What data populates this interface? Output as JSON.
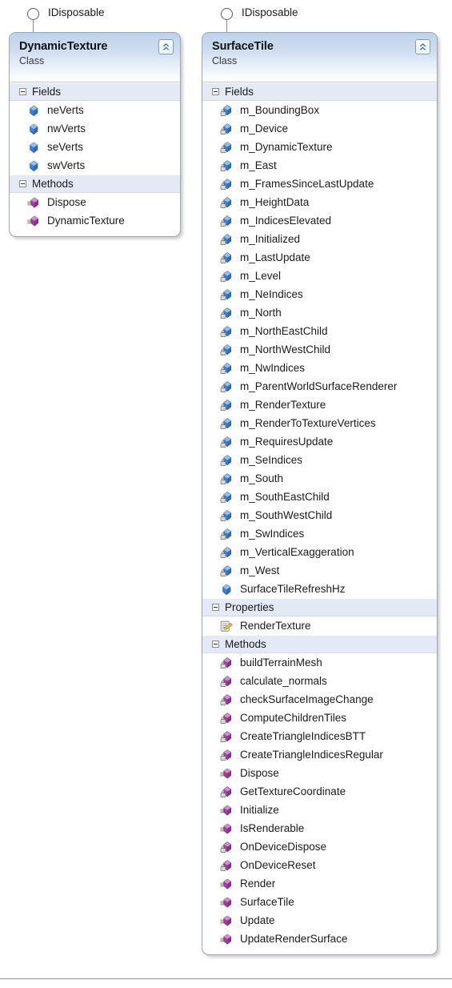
{
  "diagram": {
    "type": "uml-class-diagram",
    "background_color": "#ffffff",
    "accent_color": "#bcd2ea",
    "field_icon_color": "#3a78c8",
    "method_icon_color": "#a13fa1",
    "property_icon_color": "#e8b33c"
  },
  "classes": [
    {
      "id": "dynamic-texture",
      "name": "DynamicTexture",
      "stereotype": "Class",
      "interface_label": "IDisposable",
      "collapse_icon": "chevron-double-up-icon",
      "sections": [
        {
          "label": "Fields",
          "expander": "collapse-expander-icon",
          "members": [
            {
              "name": "neVerts",
              "icon": "field-public-icon"
            },
            {
              "name": "nwVerts",
              "icon": "field-public-icon"
            },
            {
              "name": "seVerts",
              "icon": "field-public-icon"
            },
            {
              "name": "swVerts",
              "icon": "field-public-icon"
            }
          ]
        },
        {
          "label": "Methods",
          "expander": "collapse-expander-icon",
          "members": [
            {
              "name": "Dispose",
              "icon": "method-public-icon"
            },
            {
              "name": "DynamicTexture",
              "icon": "method-public-icon"
            }
          ]
        }
      ]
    },
    {
      "id": "surface-tile",
      "name": "SurfaceTile",
      "stereotype": "Class",
      "interface_label": "IDisposable",
      "collapse_icon": "chevron-double-up-icon",
      "sections": [
        {
          "label": "Fields",
          "expander": "collapse-expander-icon",
          "members": [
            {
              "name": "m_BoundingBox",
              "icon": "field-private-icon"
            },
            {
              "name": "m_Device",
              "icon": "field-private-icon"
            },
            {
              "name": "m_DynamicTexture",
              "icon": "field-private-icon"
            },
            {
              "name": "m_East",
              "icon": "field-private-icon"
            },
            {
              "name": "m_FramesSinceLastUpdate",
              "icon": "field-private-icon"
            },
            {
              "name": "m_HeightData",
              "icon": "field-private-icon"
            },
            {
              "name": "m_IndicesElevated",
              "icon": "field-private-icon"
            },
            {
              "name": "m_Initialized",
              "icon": "field-private-icon"
            },
            {
              "name": "m_LastUpdate",
              "icon": "field-private-icon"
            },
            {
              "name": "m_Level",
              "icon": "field-private-icon"
            },
            {
              "name": "m_NeIndices",
              "icon": "field-private-icon"
            },
            {
              "name": "m_North",
              "icon": "field-private-icon"
            },
            {
              "name": "m_NorthEastChild",
              "icon": "field-private-icon"
            },
            {
              "name": "m_NorthWestChild",
              "icon": "field-private-icon"
            },
            {
              "name": "m_NwIndices",
              "icon": "field-private-icon"
            },
            {
              "name": "m_ParentWorldSurfaceRenderer",
              "icon": "field-private-icon"
            },
            {
              "name": "m_RenderTexture",
              "icon": "field-private-icon"
            },
            {
              "name": "m_RenderToTextureVertices",
              "icon": "field-private-icon"
            },
            {
              "name": "m_RequiresUpdate",
              "icon": "field-private-icon"
            },
            {
              "name": "m_SeIndices",
              "icon": "field-private-icon"
            },
            {
              "name": "m_South",
              "icon": "field-private-icon"
            },
            {
              "name": "m_SouthEastChild",
              "icon": "field-private-icon"
            },
            {
              "name": "m_SouthWestChild",
              "icon": "field-private-icon"
            },
            {
              "name": "m_SwIndices",
              "icon": "field-private-icon"
            },
            {
              "name": "m_VerticalExaggeration",
              "icon": "field-private-icon"
            },
            {
              "name": "m_West",
              "icon": "field-private-icon"
            },
            {
              "name": "SurfaceTileRefreshHz",
              "icon": "field-public-icon"
            }
          ]
        },
        {
          "label": "Properties",
          "expander": "collapse-expander-icon",
          "members": [
            {
              "name": "RenderTexture",
              "icon": "property-public-icon"
            }
          ]
        },
        {
          "label": "Methods",
          "expander": "collapse-expander-icon",
          "members": [
            {
              "name": "buildTerrainMesh",
              "icon": "method-private-icon"
            },
            {
              "name": "calculate_normals",
              "icon": "method-private-icon"
            },
            {
              "name": "checkSurfaceImageChange",
              "icon": "method-private-icon"
            },
            {
              "name": "ComputeChildrenTiles",
              "icon": "method-private-icon"
            },
            {
              "name": "CreateTriangleIndicesBTT",
              "icon": "method-private-icon"
            },
            {
              "name": "CreateTriangleIndicesRegular",
              "icon": "method-private-icon"
            },
            {
              "name": "Dispose",
              "icon": "method-public-icon"
            },
            {
              "name": "GetTextureCoordinate",
              "icon": "method-private-icon"
            },
            {
              "name": "Initialize",
              "icon": "method-public-icon"
            },
            {
              "name": "IsRenderable",
              "icon": "method-public-icon"
            },
            {
              "name": "OnDeviceDispose",
              "icon": "method-private-icon"
            },
            {
              "name": "OnDeviceReset",
              "icon": "method-private-icon"
            },
            {
              "name": "Render",
              "icon": "method-public-icon"
            },
            {
              "name": "SurfaceTile",
              "icon": "method-public-icon"
            },
            {
              "name": "Update",
              "icon": "method-public-icon"
            },
            {
              "name": "UpdateRenderSurface",
              "icon": "method-public-icon"
            }
          ]
        }
      ]
    }
  ]
}
